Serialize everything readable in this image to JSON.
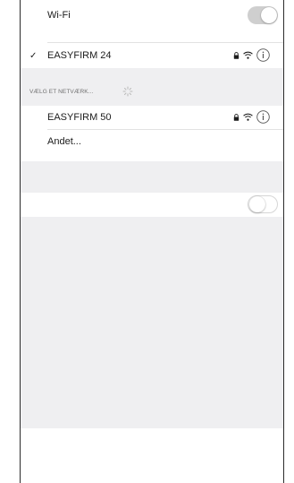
{
  "wifi": {
    "title": "Wi-Fi",
    "enabled": true
  },
  "connected": {
    "ssid": "EASYFIRM 24",
    "check": "✓",
    "icons": [
      "lock-icon",
      "wifi-signal-icon",
      "info-icon"
    ]
  },
  "networks_section": {
    "header": "VÆLG ET NETVÆRK...",
    "spinner": "loading-spinner-icon"
  },
  "networks": [
    {
      "ssid": "EASYFIRM 50",
      "icons": [
        "lock-icon",
        "wifi-signal-icon",
        "info-icon"
      ]
    },
    {
      "ssid": "Andet..."
    }
  ],
  "ask_to_join": {
    "label": "",
    "enabled": false
  },
  "colors": {
    "toggle_on": "#cfcfcf",
    "band": "#efeff1"
  }
}
